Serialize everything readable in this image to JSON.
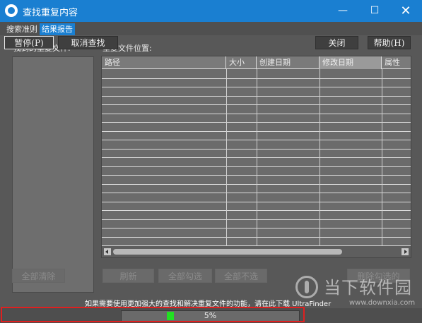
{
  "window": {
    "title": "查找重复内容",
    "minimize": "—",
    "maximize": "☐",
    "close": "✕"
  },
  "tabs": [
    {
      "label": "搜索准则",
      "active": false
    },
    {
      "label": "结果报告",
      "active": true
    }
  ],
  "left_panel": {
    "label": "找到的重复文件:"
  },
  "right_panel": {
    "label": "重复文件位置:",
    "columns": [
      "路径",
      "大小",
      "创建日期",
      "修改日期",
      "属性"
    ],
    "active_column": "修改日期"
  },
  "buttons": {
    "clear_all": "全部清除",
    "refresh": "刷新",
    "check_all": "全部勾选",
    "uncheck_all": "全部不选",
    "delete_checked": "删除勾选的"
  },
  "notice": "如果需要使用更加强大的查找和解决重复文件的功能，请在此下载 UltraFinder",
  "watermark": {
    "text": "当下软件园",
    "url": "www.downxia.com"
  },
  "bottom": {
    "pause": "暂停(P)",
    "cancel_search": "取消查找",
    "progress_text": "5%",
    "progress_value": 0.05,
    "close": "关闭",
    "help": "帮助(H)"
  },
  "colors": {
    "accent": "#1a7fd1",
    "progress": "#22e022",
    "highlight": "#e02020"
  }
}
